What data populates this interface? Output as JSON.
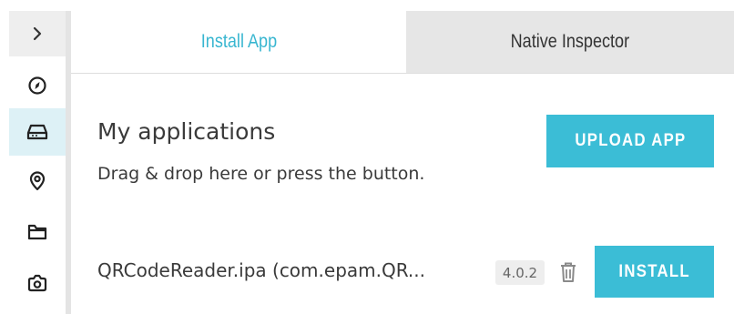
{
  "sidebar": {
    "expand_icon": "chevron-right-icon",
    "items": [
      {
        "icon": "compass-icon",
        "active": false
      },
      {
        "icon": "hard-drive-icon",
        "active": true
      },
      {
        "icon": "location-pin-icon",
        "active": false
      },
      {
        "icon": "folder-icon",
        "active": false
      },
      {
        "icon": "camera-icon",
        "active": false
      }
    ]
  },
  "tabs": [
    {
      "label": "Install App",
      "active": true
    },
    {
      "label": "Native Inspector",
      "active": false
    }
  ],
  "main": {
    "title": "My applications",
    "hint": "Drag & drop here or press the button.",
    "upload_label": "UPLOAD APP",
    "apps": [
      {
        "name": "QRCodeReader.ipa (com.epam.QR...",
        "version": "4.0.2",
        "install_label": "INSTALL",
        "delete_icon": "trash-icon"
      }
    ]
  },
  "colors": {
    "accent": "#3bbdd6",
    "active_rail_bg": "#ddf1f6",
    "inactive_tab_bg": "#e6e6e6",
    "text": "#3a3a3a"
  }
}
